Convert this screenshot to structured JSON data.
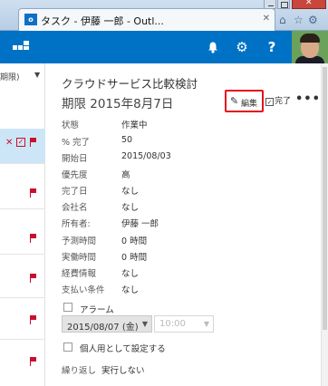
{
  "browser": {
    "tab_title": "タスク - 伊藤 一郎 - Outl...",
    "tab_icon": "outlook-icon",
    "tab_icon_text": "o"
  },
  "header": {
    "icons": [
      "app-launcher-icon",
      "bell-icon",
      "gear-icon",
      "help-icon"
    ],
    "help_label": "?",
    "accent": "#0072c6"
  },
  "list": {
    "filter_label": "期限)",
    "flag_color": "#c8102e",
    "selected_color": "#cde6f7"
  },
  "task": {
    "subject": "クラウドサービス比較検討",
    "due": "期限 2015年8月7日",
    "toolbar": {
      "edit_label": "編集",
      "done_label": "完了",
      "more_label": "•••"
    },
    "properties": [
      {
        "label": "状態",
        "value": "作業中"
      },
      {
        "label": "% 完了",
        "value": "50"
      },
      {
        "label": "開始日",
        "value": "2015/08/03"
      },
      {
        "label": "優先度",
        "value": "高"
      },
      {
        "label": "完了日",
        "value": "なし"
      },
      {
        "label": "会社名",
        "value": "なし"
      },
      {
        "label": "所有者:",
        "value": "伊藤 一郎"
      },
      {
        "label": "予測時間",
        "value": "0 時間"
      },
      {
        "label": "実働時間",
        "value": "0 時間"
      },
      {
        "label": "経費情報",
        "value": "なし"
      },
      {
        "label": "支払い条件",
        "value": "なし"
      }
    ],
    "alarm": {
      "label": "アラーム",
      "date_value": "2015/08/07 (金)",
      "time_value": "10:00",
      "checked": false
    },
    "private_label": "個人用として設定する",
    "recurrence_label": "繰り返し",
    "recurrence_value": "実行しない"
  }
}
